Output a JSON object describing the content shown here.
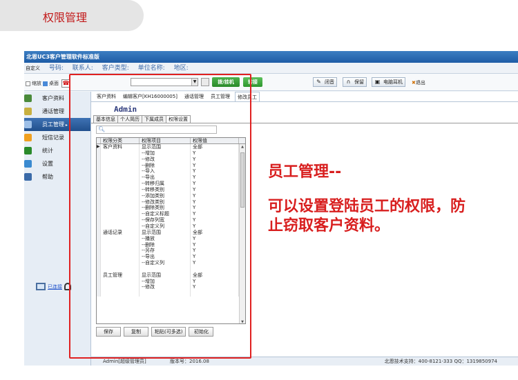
{
  "page_tab": "权限管理",
  "app": {
    "title": "北恩UC3客户管理软件标准版",
    "info_bar": {
      "first": "自定义",
      "labels": [
        "号码:",
        "联系人:",
        "客户类型:",
        "单位名称:",
        "地区:"
      ]
    },
    "toolbar": {
      "shrink": "缩放",
      "desktop": "桌面",
      "dial_label": "拨/挂机",
      "transfer_label": "转接",
      "mute_label": "闭音",
      "hold_label": "保留",
      "headset_label": "电脑耳机",
      "exit_label": "退出"
    },
    "sidebar": {
      "items": [
        {
          "label": "客户资料",
          "icon": "customer-icon",
          "color": "#4a8a3a"
        },
        {
          "label": "通话管理",
          "icon": "call-icon",
          "color": "#c8b040"
        },
        {
          "label": "员工管理",
          "icon": "staff-icon",
          "color": "#3a6aa8"
        },
        {
          "label": "短信记录",
          "icon": "sms-icon",
          "color": "#f0a020"
        },
        {
          "label": "统计",
          "icon": "stats-icon",
          "color": "#2a8a2a"
        },
        {
          "label": "设置",
          "icon": "settings-icon",
          "color": "#3a8ad0"
        },
        {
          "label": "帮助",
          "icon": "help-icon",
          "color": "#3a6aa8"
        }
      ],
      "connection": "已连接"
    },
    "content": {
      "tabs": [
        "客户资料",
        "编辑客户[KH16000005]",
        "通话管理",
        "员工管理",
        "修改员工"
      ],
      "user_name": "Admin",
      "sub_tabs": [
        "基本信息",
        "个人简历",
        "下属成员",
        "权限设置"
      ],
      "grid": {
        "headers": [
          "权限分类",
          "权限项目",
          "权限值"
        ],
        "rows": [
          {
            "category": "客户资料",
            "item": "显示范围",
            "value": "全部",
            "marker": "▶"
          },
          {
            "category": "",
            "item": "--增加",
            "value": "Y"
          },
          {
            "category": "",
            "item": "--修改",
            "value": "Y"
          },
          {
            "category": "",
            "item": "--删除",
            "value": "Y"
          },
          {
            "category": "",
            "item": "--导入",
            "value": "Y"
          },
          {
            "category": "",
            "item": "--导出",
            "value": "Y"
          },
          {
            "category": "",
            "item": "--转移归属",
            "value": "Y"
          },
          {
            "category": "",
            "item": "--转移类别",
            "value": "Y"
          },
          {
            "category": "",
            "item": "--添加类别",
            "value": "Y"
          },
          {
            "category": "",
            "item": "--修改类别",
            "value": "Y"
          },
          {
            "category": "",
            "item": "--删除类别",
            "value": "Y"
          },
          {
            "category": "",
            "item": "--自定义标题",
            "value": "Y"
          },
          {
            "category": "",
            "item": "--保存列宽",
            "value": "Y"
          },
          {
            "category": "",
            "item": "--自定义列",
            "value": "Y"
          },
          {
            "category": "通话记录",
            "item": "显示范围",
            "value": "全部"
          },
          {
            "category": "",
            "item": "--播放",
            "value": "Y"
          },
          {
            "category": "",
            "item": "--删除",
            "value": "Y"
          },
          {
            "category": "",
            "item": "--另存",
            "value": "Y"
          },
          {
            "category": "",
            "item": "--导出",
            "value": "Y"
          },
          {
            "category": "",
            "item": "--自定义列",
            "value": "Y"
          },
          {
            "category": "",
            "item": "",
            "value": ""
          },
          {
            "category": "员工管理",
            "item": "显示范围",
            "value": "全部"
          },
          {
            "category": "",
            "item": "--增加",
            "value": "Y"
          },
          {
            "category": "",
            "item": "--修改",
            "value": "Y"
          },
          {
            "category": "",
            "item": "",
            "value": ""
          }
        ]
      },
      "buttons": {
        "save": "保存",
        "copy": "复制",
        "paste": "粘贴(可多选)",
        "init": "初始化"
      }
    },
    "status": {
      "user": "Admin[超级管理员]",
      "version": "版本号：2016.08",
      "support": "北恩技术支持：400-8121-333 QQ：1319850974"
    }
  },
  "annotation": {
    "title": "员工管理--",
    "body": "可以设置登陆员工的权限，防止窃取客户资料。",
    "color": "#d81e1e"
  }
}
